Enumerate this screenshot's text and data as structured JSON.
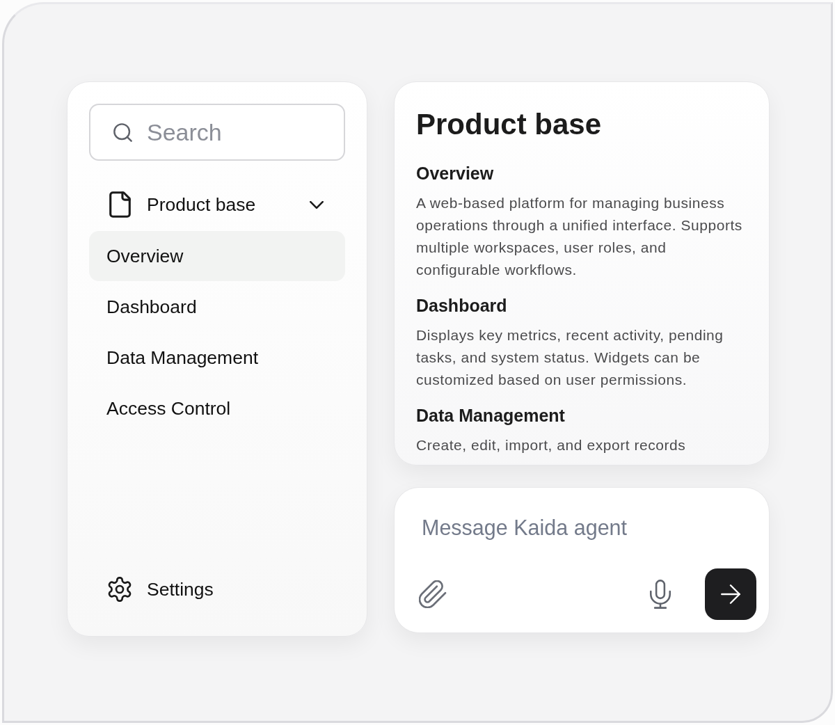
{
  "sidebar": {
    "search": {
      "placeholder": "Search"
    },
    "section": {
      "label": "Product base",
      "expanded": true
    },
    "items": [
      {
        "label": "Overview",
        "selected": true
      },
      {
        "label": "Dashboard",
        "selected": false
      },
      {
        "label": "Data Management",
        "selected": false
      },
      {
        "label": "Access Control",
        "selected": false
      }
    ],
    "settings": {
      "label": "Settings"
    }
  },
  "document": {
    "title": "Product base",
    "sections": [
      {
        "heading": "Overview",
        "body": "A web-based platform for managing business operations through a unified interface. Supports multiple workspaces, user roles, and configurable workflows."
      },
      {
        "heading": "Dashboard",
        "body": "Displays key metrics, recent activity, pending tasks, and system status. Widgets can be customized based on user permissions."
      },
      {
        "heading": "Data Management",
        "body": "Create, edit, import, and export records"
      }
    ]
  },
  "composer": {
    "placeholder": "Message Kaida agent"
  }
}
